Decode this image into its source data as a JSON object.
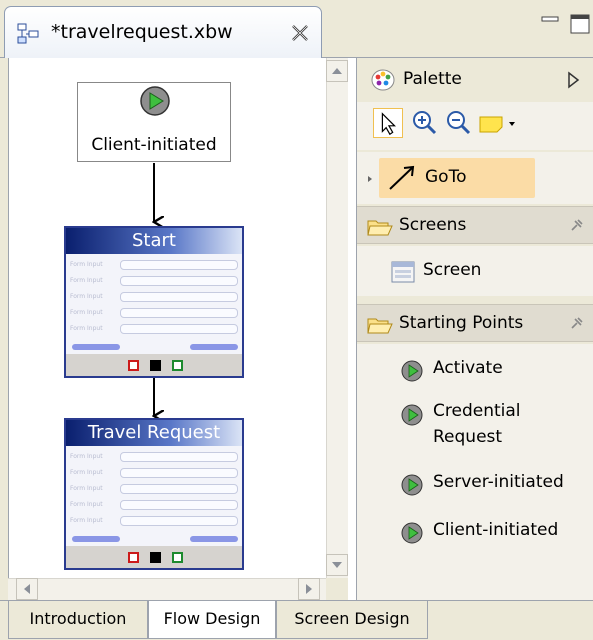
{
  "editor": {
    "tab_title": "*travelrequest.xbw"
  },
  "canvas": {
    "client_node_label": "Client-initiated",
    "start_screen_title": "Start",
    "travel_screen_title": "Travel Request",
    "form_field_label": "Form Input"
  },
  "palette": {
    "header_label": "Palette",
    "goto_label": "GoTo",
    "screens_drawer": {
      "label": "Screens",
      "items": [
        "Screen"
      ]
    },
    "starting_points_drawer": {
      "label": "Starting Points",
      "items": [
        "Activate",
        "Credential Request",
        "Server-initiated",
        "Client-initiated"
      ]
    }
  },
  "bottom_tabs": [
    "Introduction",
    "Flow Design",
    "Screen Design"
  ],
  "active_tab": "Flow Design",
  "colors": {
    "play_green": "#3fbf3f",
    "screen_title_blue": "#0a1f6e",
    "goto_highlight": "#fbdca6"
  }
}
